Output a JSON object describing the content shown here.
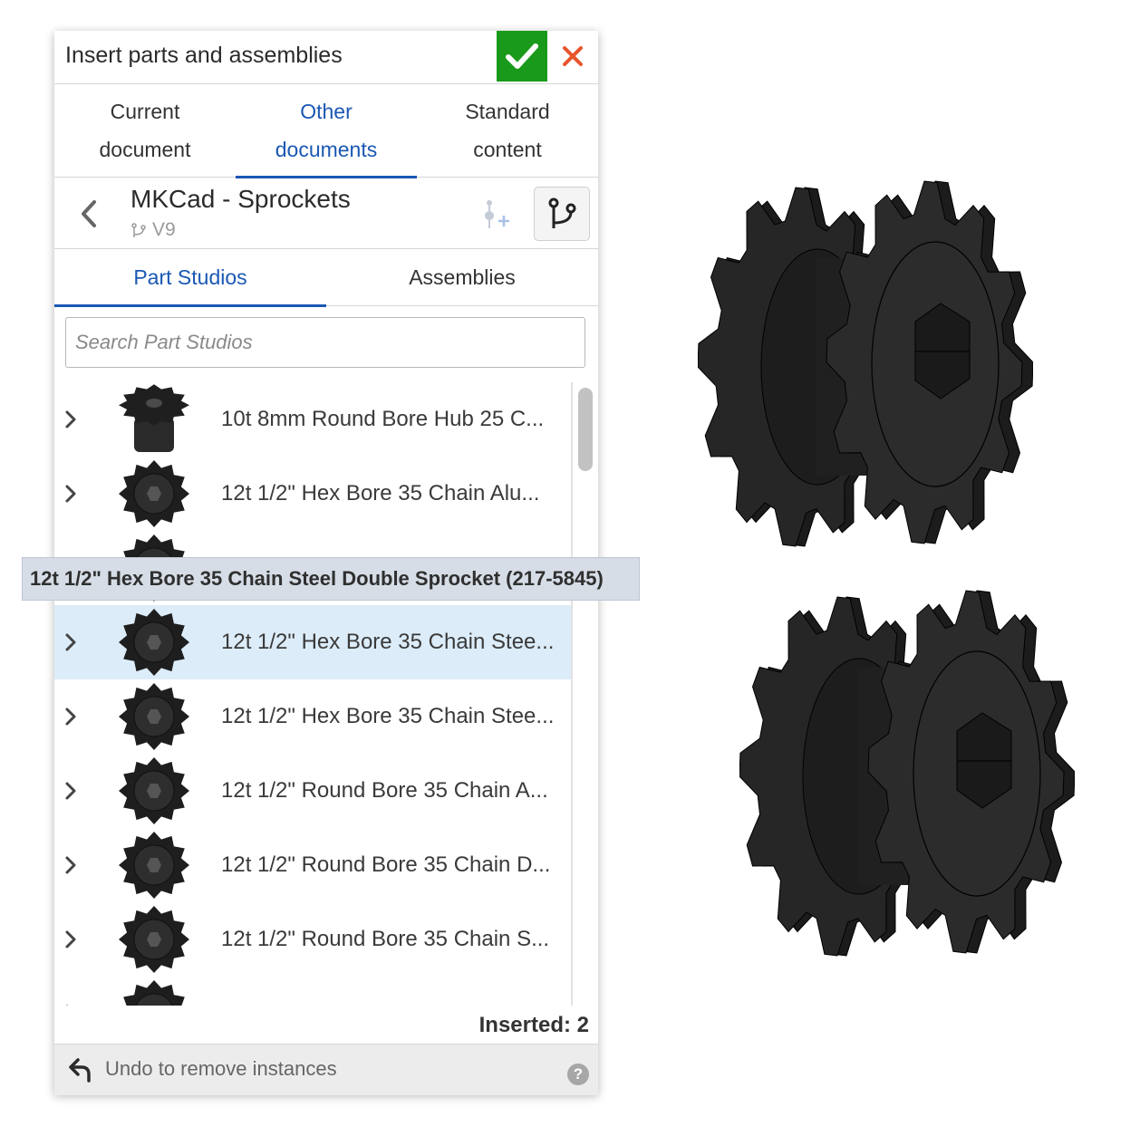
{
  "dialog": {
    "title": "Insert parts and assemblies",
    "icons": {
      "confirm": "checkmark-icon",
      "cancel": "close-x-icon"
    },
    "colors": {
      "confirm_bg": "#1a9a1a",
      "cancel": "#e8552b",
      "accent": "#1a58b4",
      "selected_row": "#dcecf9"
    }
  },
  "tabs": [
    {
      "line1": "Current",
      "line2": "document",
      "active": false
    },
    {
      "line1": "Other",
      "line2": "documents",
      "active": true
    },
    {
      "line1": "Standard",
      "line2": "content",
      "active": false
    }
  ],
  "document": {
    "name": "MKCad - Sprockets",
    "version": "V9",
    "icons": {
      "back": "chevron-left-icon",
      "version": "branch-icon",
      "add_version": "add-version-icon",
      "branch": "branch-icon"
    }
  },
  "subtabs": [
    {
      "label": "Part Studios",
      "active": true
    },
    {
      "label": "Assemblies",
      "active": false
    }
  ],
  "search": {
    "placeholder": "Search Part Studios",
    "value": ""
  },
  "items": [
    {
      "name": "10t 8mm Round Bore Hub 25 C...",
      "selected": false,
      "thumb": "sprocket-hub-thumbnail"
    },
    {
      "name": "12t 1/2\" Hex Bore 35 Chain Alu...",
      "selected": false,
      "thumb": "sprocket-thumbnail"
    },
    {
      "name": "",
      "selected": false,
      "thumb": "sprocket-thumbnail"
    },
    {
      "name": "12t 1/2\" Hex Bore 35 Chain Stee...",
      "selected": true,
      "thumb": "sprocket-thumbnail"
    },
    {
      "name": "12t 1/2\" Hex Bore 35 Chain Stee...",
      "selected": false,
      "thumb": "sprocket-thumbnail"
    },
    {
      "name": "12t 1/2\" Round Bore 35 Chain A...",
      "selected": false,
      "thumb": "sprocket-thumbnail"
    },
    {
      "name": "12t 1/2\" Round Bore 35 Chain D...",
      "selected": false,
      "thumb": "sprocket-thumbnail"
    },
    {
      "name": "12t 1/2\" Round Bore 35 Chain S...",
      "selected": false,
      "thumb": "sprocket-thumbnail"
    },
    {
      "name": "",
      "selected": false,
      "thumb": "sprocket-thumbnail"
    }
  ],
  "tooltip": "12t 1/2\" Hex Bore 35 Chain Steel Double Sprocket (217-5845)",
  "status": {
    "inserted": "Inserted: 2"
  },
  "footer": {
    "undo_label": "Undo to remove instances",
    "undo_icon": "undo-arrow-icon",
    "help_icon": "help-icon",
    "help_glyph": "?"
  },
  "viewport": {
    "models": [
      "double-sprocket-model",
      "double-sprocket-model"
    ],
    "color": "#2a2a2a"
  }
}
